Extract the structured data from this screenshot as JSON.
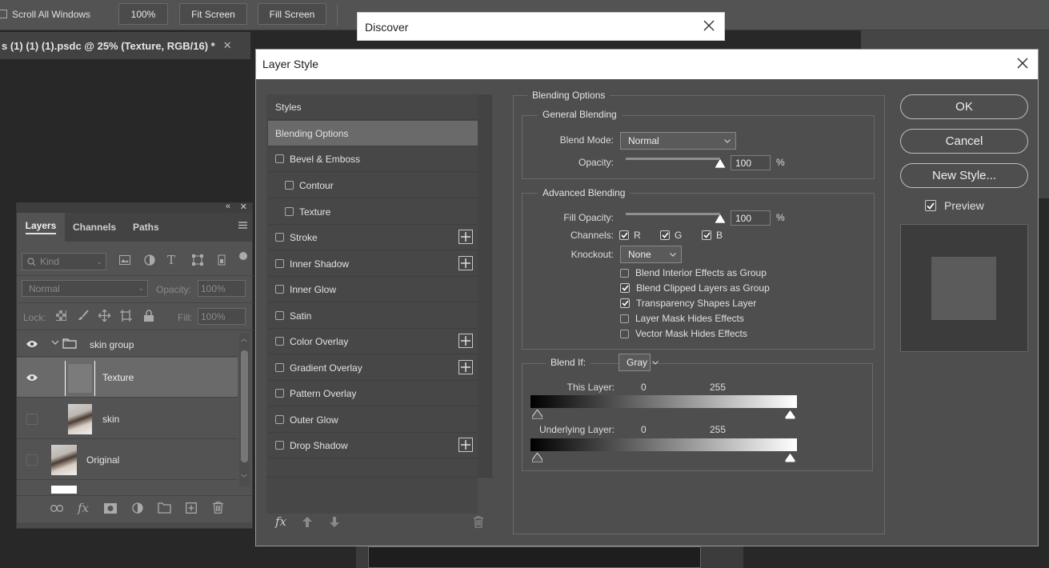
{
  "options_bar": {
    "scroll_all_windows": "Scroll All Windows",
    "zoom_button": "100%",
    "fit_screen": "Fit Screen",
    "fill_screen": "Fill Screen"
  },
  "document_tab": {
    "title": "s (1) (1) (1).psdc @ 25% (Texture, RGB/16) *"
  },
  "discover": {
    "title": "Discover"
  },
  "layers_panel": {
    "tabs": [
      "Layers",
      "Channels",
      "Paths"
    ],
    "filter_kind": "Kind",
    "blend_mode": "Normal",
    "opacity_label": "Opacity:",
    "opacity_value": "100%",
    "lock_label": "Lock:",
    "fill_label": "Fill:",
    "fill_value": "100%",
    "layers": [
      {
        "name": "skin group"
      },
      {
        "name": "Texture"
      },
      {
        "name": "skin"
      },
      {
        "name": "Original"
      }
    ]
  },
  "dialog": {
    "title": "Layer Style",
    "styles_header": "Styles",
    "style_items": [
      {
        "label": "Blending Options"
      },
      {
        "label": "Bevel & Emboss"
      },
      {
        "label": "Contour"
      },
      {
        "label": "Texture"
      },
      {
        "label": "Stroke"
      },
      {
        "label": "Inner Shadow"
      },
      {
        "label": "Inner Glow"
      },
      {
        "label": "Satin"
      },
      {
        "label": "Color Overlay"
      },
      {
        "label": "Gradient Overlay"
      },
      {
        "label": "Pattern Overlay"
      },
      {
        "label": "Outer Glow"
      },
      {
        "label": "Drop Shadow"
      }
    ],
    "fx_label": "fx",
    "blending": {
      "section_title": "Blending Options",
      "general_title": "General Blending",
      "blend_mode_label": "Blend Mode:",
      "blend_mode_value": "Normal",
      "opacity_label": "Opacity:",
      "opacity_value": "100",
      "opacity_level": 1.0,
      "percent": "%",
      "advanced_title": "Advanced Blending",
      "fill_opacity_label": "Fill Opacity:",
      "fill_opacity_value": "100",
      "fill_opacity_level": 1.0,
      "channels_label": "Channels:",
      "channel_r": "R",
      "channel_g": "G",
      "channel_b": "B",
      "knockout_label": "Knockout:",
      "knockout_value": "None",
      "checks": [
        {
          "label": "Blend Interior Effects as Group",
          "checked": false
        },
        {
          "label": "Blend Clipped Layers as Group",
          "checked": true
        },
        {
          "label": "Transparency Shapes Layer",
          "checked": true
        },
        {
          "label": "Layer Mask Hides Effects",
          "checked": false
        },
        {
          "label": "Vector Mask Hides Effects",
          "checked": false
        }
      ],
      "blend_if_label": "Blend If:",
      "blend_if_value": "Gray",
      "this_layer_label": "This Layer:",
      "this_layer_low": "0",
      "this_layer_high": "255",
      "underlying_label": "Underlying Layer:",
      "underlying_low": "0",
      "underlying_high": "255"
    },
    "buttons": {
      "ok": "OK",
      "cancel": "Cancel",
      "new_style": "New Style...",
      "preview_label": "Preview"
    }
  }
}
